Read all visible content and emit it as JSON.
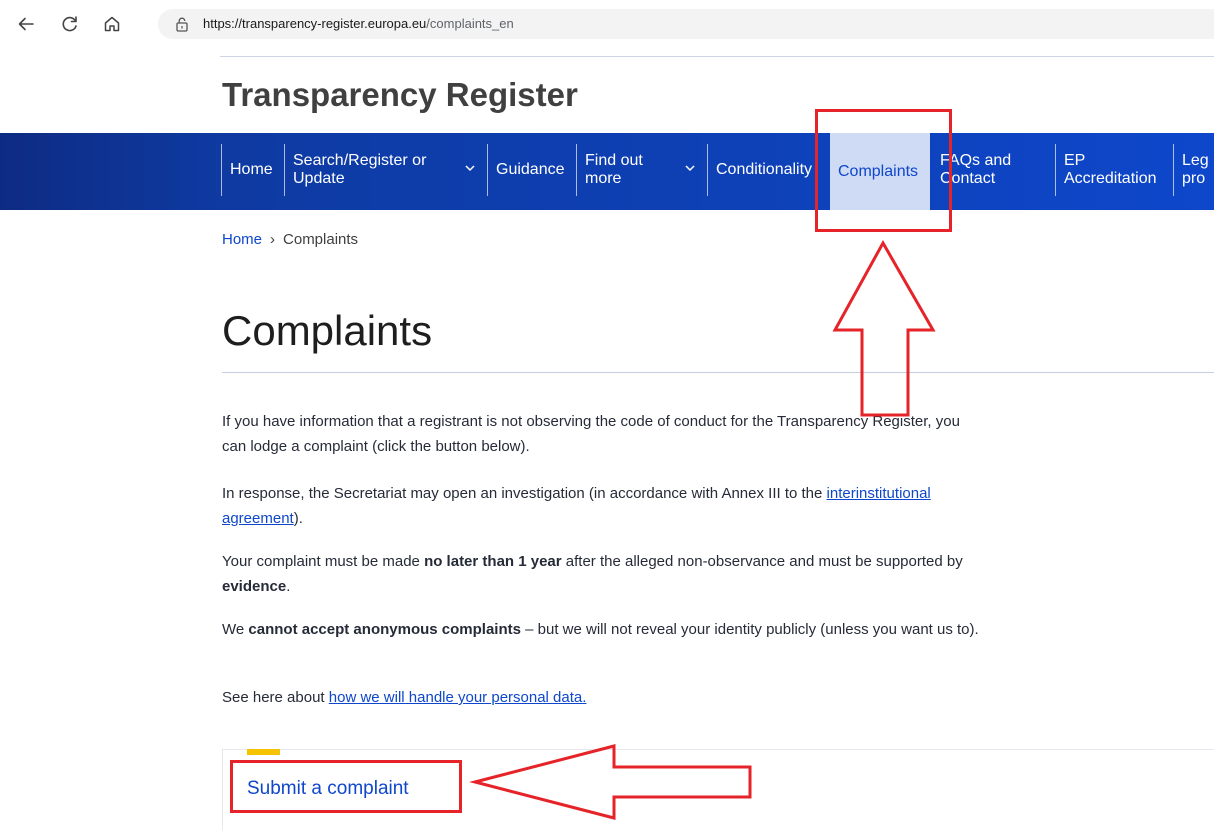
{
  "browser": {
    "url_host": "https://transparency-register.europa.eu",
    "url_path": "/complaints_en"
  },
  "site": {
    "title": "Transparency Register"
  },
  "nav": {
    "items": [
      {
        "line1": "Home",
        "line2": ""
      },
      {
        "line1": "Search/Register or",
        "line2": "Update"
      },
      {
        "line1": "Guidance",
        "line2": ""
      },
      {
        "line1": "Find out",
        "line2": "more"
      },
      {
        "line1": "Conditionality",
        "line2": ""
      },
      {
        "line1": "Complaints",
        "line2": ""
      },
      {
        "line1": "FAQs and",
        "line2": "Contact"
      },
      {
        "line1": "EP",
        "line2": "Accreditation"
      },
      {
        "line1": "Leg",
        "line2": "pro"
      }
    ]
  },
  "breadcrumb": {
    "home": "Home",
    "separator": "›",
    "current": "Complaints"
  },
  "page": {
    "title": "Complaints",
    "p1": "If you have information that a registrant is not observing the code of conduct for the Transparency Register, you can lodge a complaint (click the button below).",
    "p2_before": "In response, the Secretariat may open an investigation (in accordance with Annex III to the ",
    "p2_link": "interinstitutional agreement",
    "p2_after": ").",
    "p3_a": "Your complaint must be made ",
    "p3_b": "no later than 1 year",
    "p3_c": " after the alleged non-observance and must be supported by ",
    "p3_d": "evidence",
    "p3_e": ".",
    "p4_a": "We ",
    "p4_b": "cannot accept anonymous complaints",
    "p4_c": " – but we will not reveal your identity publicly (unless you want us to).",
    "p5_before": "See here about ",
    "p5_link": "how we will handle your personal data."
  },
  "card": {
    "link": "Submit a complaint"
  },
  "colors": {
    "nav_blue": "#0e47cb",
    "active_bg": "#cfdaf5",
    "annotation_red": "#e52328",
    "accent_yellow": "#f5c300"
  }
}
